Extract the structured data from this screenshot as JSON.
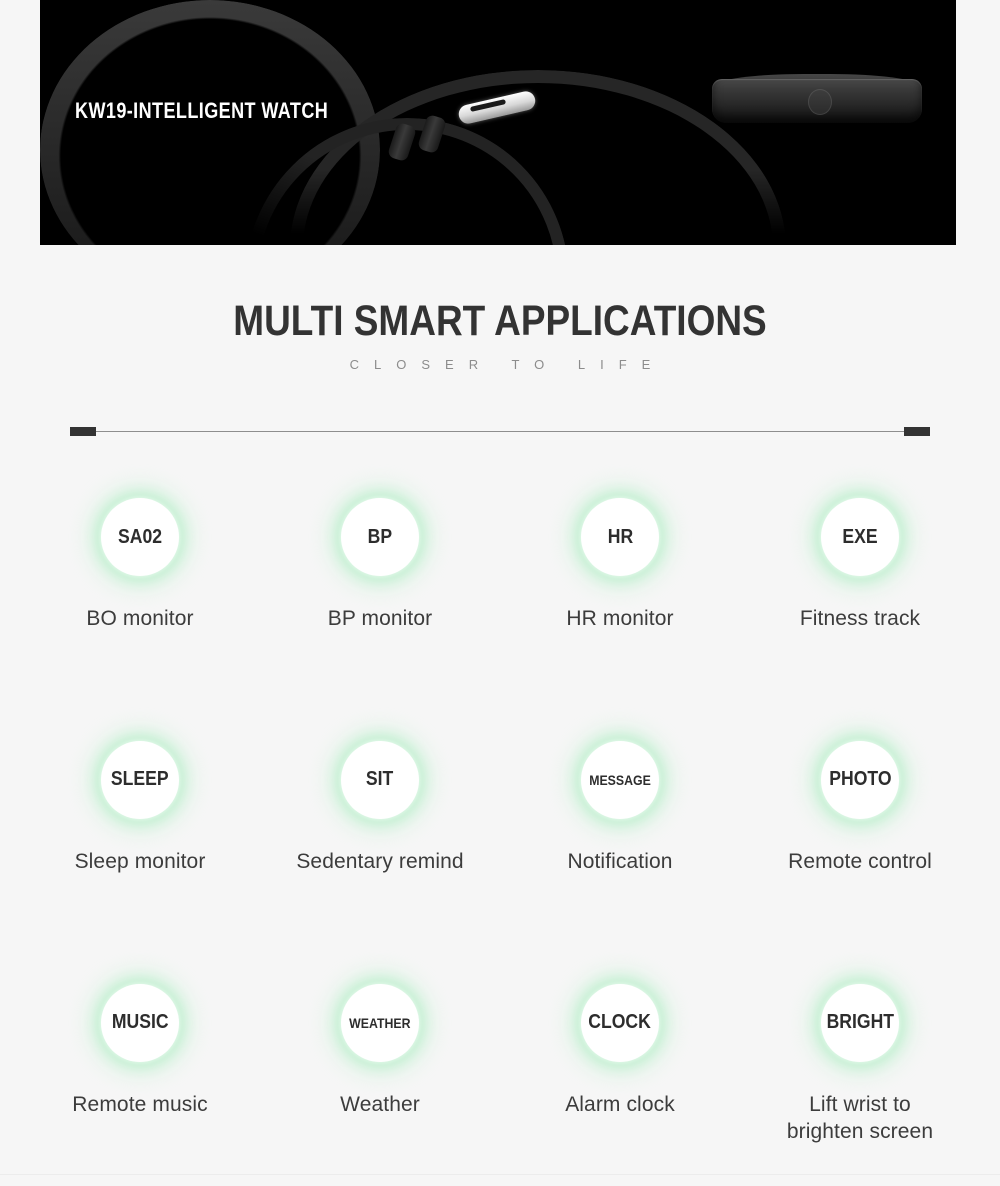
{
  "hero": {
    "product_title": "KW19-INTELLIGENT WATCH",
    "background_color": "#000000",
    "image_alt": "black smart watch side profile with silicone strap and silver buckle"
  },
  "section": {
    "title": "MULTI SMART APPLICATIONS",
    "subtitle": "CLOSER TO LIFE",
    "title_color": "#333333",
    "subtitle_color": "#8c8c8c"
  },
  "divider": {
    "cap_color": "#333333",
    "line_color": "#8e8e8e"
  },
  "theme": {
    "page_background": "#f6f6f6",
    "glow_color": "#46d676",
    "badge_background": "#ffffff",
    "caption_color": "#3c3c3c"
  },
  "features": [
    {
      "badge": "SA02",
      "badge_size": "normal",
      "caption": "BO monitor"
    },
    {
      "badge": "BP",
      "badge_size": "normal",
      "caption": "BP monitor"
    },
    {
      "badge": "HR",
      "badge_size": "normal",
      "caption": "HR monitor"
    },
    {
      "badge": "EXE",
      "badge_size": "normal",
      "caption": "Fitness track"
    },
    {
      "badge": "SLEEP",
      "badge_size": "normal",
      "caption": "Sleep monitor"
    },
    {
      "badge": "SIT",
      "badge_size": "normal",
      "caption": "Sedentary remind"
    },
    {
      "badge": "MESSAGE",
      "badge_size": "small",
      "caption": "Notification"
    },
    {
      "badge": "PHOTO",
      "badge_size": "normal",
      "caption": "Remote control"
    },
    {
      "badge": "MUSIC",
      "badge_size": "normal",
      "caption": "Remote music"
    },
    {
      "badge": "WEATHER",
      "badge_size": "small",
      "caption": "Weather"
    },
    {
      "badge": "CLOCK",
      "badge_size": "normal",
      "caption": "Alarm clock"
    },
    {
      "badge": "BRIGHT",
      "badge_size": "normal",
      "caption": "Lift wrist to\nbrighten screen"
    }
  ]
}
